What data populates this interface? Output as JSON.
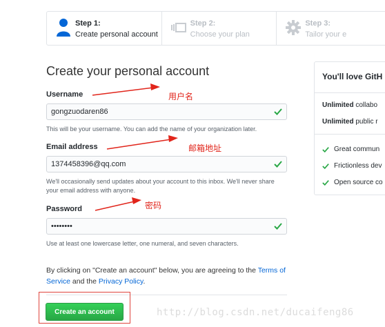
{
  "steps": [
    {
      "title": "Step 1:",
      "subtitle": "Create personal account",
      "icon": "person-icon",
      "active": true
    },
    {
      "title": "Step 2:",
      "subtitle": "Choose your plan",
      "icon": "plan-icon",
      "active": false
    },
    {
      "title": "Step 3:",
      "subtitle": "Tailor your e",
      "icon": "gear-icon",
      "active": false
    }
  ],
  "form": {
    "title": "Create your personal account",
    "username_label": "Username",
    "username_value": "gongzuodaren86",
    "username_note": "This will be your username. You can add the name of your organization later.",
    "email_label": "Email address",
    "email_value": "1374458396@qq.com",
    "email_note": "We'll occasionally send updates about your account to this inbox. We'll never share your email address with anyone.",
    "password_label": "Password",
    "password_value": "••••••••",
    "password_note": "Use at least one lowercase letter, one numeral, and seven characters.",
    "agree_prefix": "By clicking on \"Create an account\" below, you are agreeing to the ",
    "terms_link": "Terms of Service",
    "agree_mid": " and the ",
    "privacy_link": "Privacy Policy",
    "agree_suffix": ".",
    "submit_label": "Create an account"
  },
  "card": {
    "title": "You'll love GitH",
    "rows": [
      {
        "bold": "Unlimited",
        "text": " collabo"
      },
      {
        "bold": "Unlimited",
        "text": " public r"
      }
    ],
    "features": [
      "Great commun",
      "Frictionless dev",
      "Open source co"
    ]
  },
  "annotations": {
    "username": "用户名",
    "email": "邮箱地址",
    "password": "密码",
    "watermark": "http://blog.csdn.net/ducaifeng86"
  },
  "colors": {
    "accent": "#28a745",
    "link": "#0366d6",
    "annotation": "#e1251b"
  }
}
